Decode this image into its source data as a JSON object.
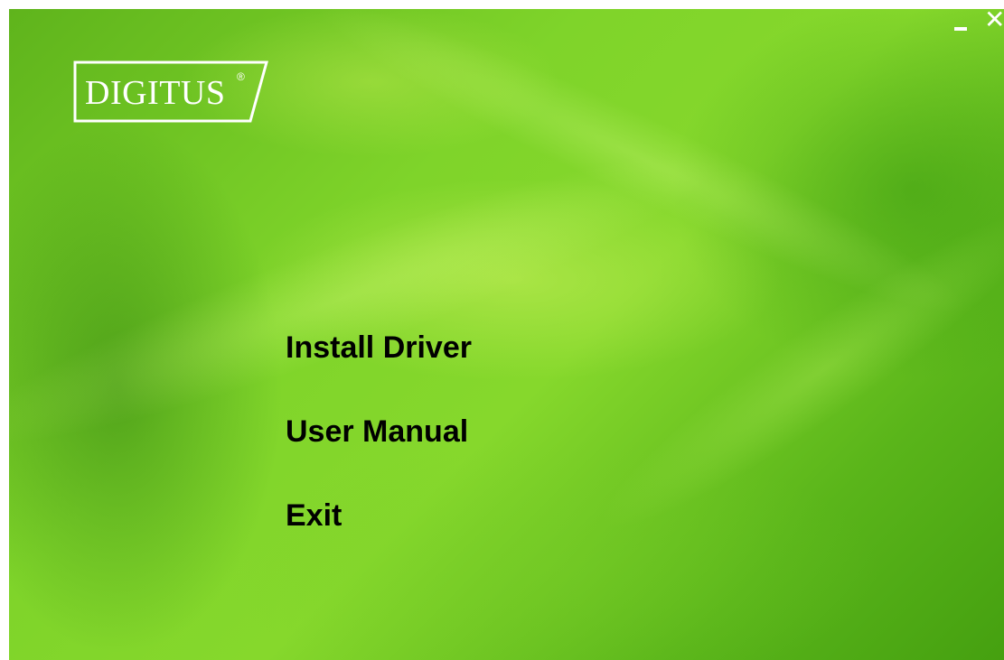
{
  "brand": {
    "logo_text": "DIGITUS",
    "registered_mark": "®"
  },
  "window_controls": {
    "minimize_icon": "minimize-icon",
    "close_icon": "close-icon",
    "close_glyph": "✕"
  },
  "menu": {
    "items": [
      {
        "label": "Install Driver"
      },
      {
        "label": "User Manual"
      },
      {
        "label": "Exit"
      }
    ]
  },
  "colors": {
    "background": "#7fd42a",
    "menu_text": "#000000",
    "logo": "#ffffff"
  }
}
